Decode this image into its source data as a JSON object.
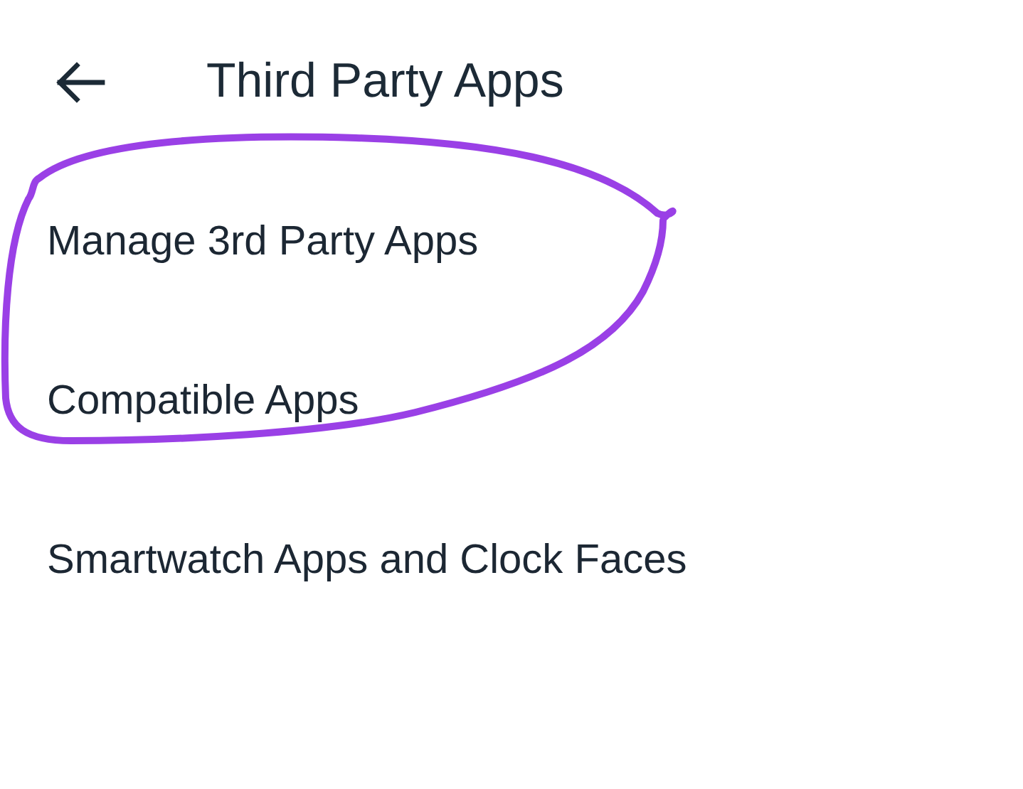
{
  "header": {
    "title": "Third Party Apps"
  },
  "items": [
    {
      "label": "Manage 3rd Party Apps"
    },
    {
      "label": "Compatible Apps"
    },
    {
      "label": "Smartwatch Apps and Clock Faces"
    }
  ]
}
